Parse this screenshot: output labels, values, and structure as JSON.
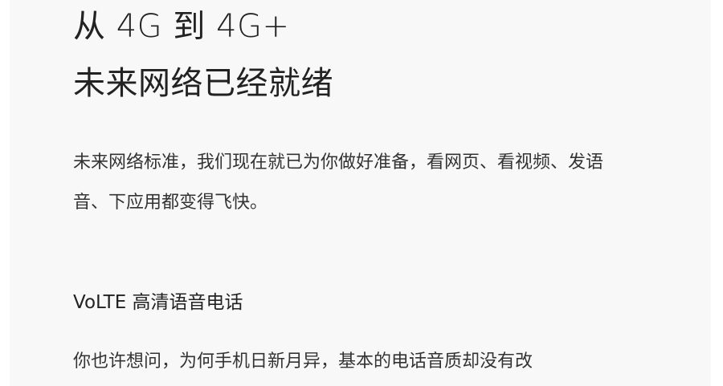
{
  "hero": {
    "title_line1": "从 4G 到 4G+",
    "title_line2": "未来网络已经就绪"
  },
  "intro": {
    "paragraph": "未来网络标准，我们现在就已为你做好准备，看网页、看视频、发语音、下应用都变得飞快。"
  },
  "volte": {
    "heading": "VoLTE 高清语音电话",
    "paragraph": "你也许想问，为何手机日新月异，基本的电话音质却没有改"
  }
}
